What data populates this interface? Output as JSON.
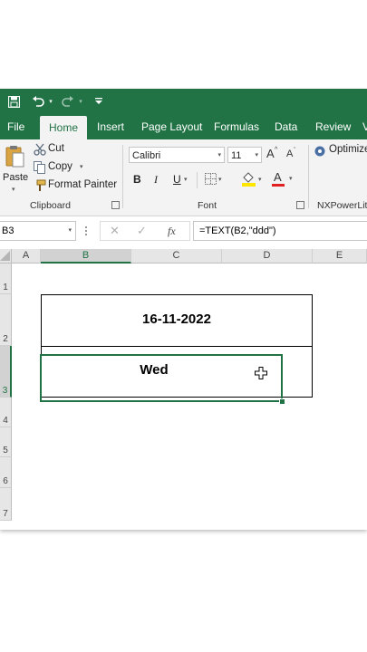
{
  "menu": {
    "file": "File",
    "home": "Home",
    "insert": "Insert",
    "page_layout": "Page Layout",
    "formulas": "Formulas",
    "data": "Data",
    "review": "Review",
    "more": "V"
  },
  "ribbon": {
    "clipboard": {
      "paste": "Paste",
      "cut": "Cut",
      "copy": "Copy",
      "format_painter": "Format Painter",
      "label": "Clipboard"
    },
    "font": {
      "font_name": "Calibri",
      "font_size": "11",
      "bold": "B",
      "italic": "I",
      "underline": "U",
      "grow": "A",
      "shrink": "A",
      "font_color": "A",
      "label": "Font"
    },
    "nx": {
      "optimize": "Optimize",
      "label": "NXPowerLite"
    }
  },
  "formula_bar": {
    "name_box": "B3",
    "fx": "fx",
    "formula": "=TEXT(B2,\"ddd\")"
  },
  "grid": {
    "columns": [
      "A",
      "B",
      "C",
      "D",
      "E"
    ],
    "rows": [
      "1",
      "2",
      "3",
      "4",
      "5",
      "6",
      "7"
    ],
    "selected_column": "B",
    "selected_row": "3"
  },
  "cells": {
    "B2": "16-11-2022",
    "B3": "Wed"
  },
  "colors": {
    "accent": "#217346",
    "ribbon_bg": "#f3f3f3",
    "header_bg": "#e6e6e6"
  }
}
